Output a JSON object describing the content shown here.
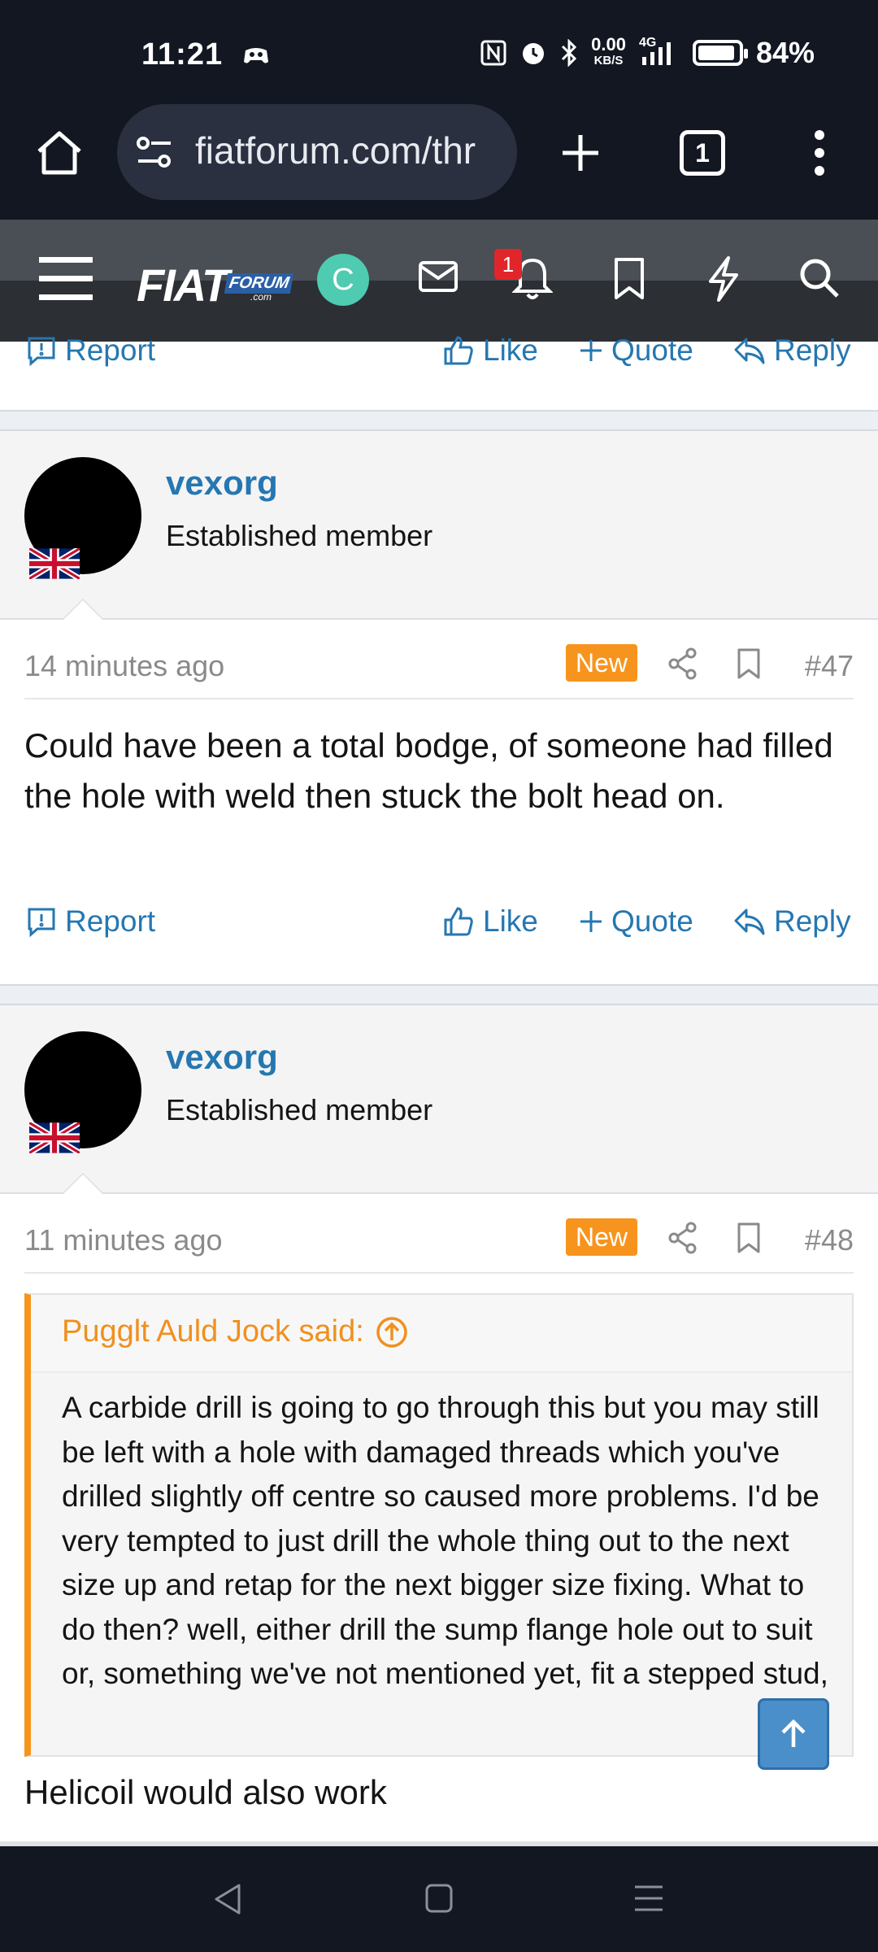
{
  "status_bar": {
    "time": "11:21",
    "net_speed_top": "0.00",
    "net_speed_bottom": "KB/S",
    "network": "4G",
    "battery": "84%"
  },
  "browser": {
    "url": "fiatforum.com/thr",
    "tab_count": "1"
  },
  "forum_nav": {
    "avatar_letter": "C",
    "notification_count": "1"
  },
  "top_actions": {
    "report": "Report",
    "like": "Like",
    "quote": "Quote",
    "reply": "Reply"
  },
  "posts": [
    {
      "username": "vexorg",
      "user_title": "Established member",
      "time": "14 minutes ago",
      "badge": "New",
      "number": "#47",
      "text": "Could have been a total bodge, of someone had filled the hole with weld then stuck the bolt head on.",
      "actions": {
        "report": "Report",
        "like": "Like",
        "quote": "Quote",
        "reply": "Reply"
      }
    },
    {
      "username": "vexorg",
      "user_title": "Established member",
      "time": "11 minutes ago",
      "badge": "New",
      "number": "#48",
      "quote_author": "Pugglt Auld Jock said:",
      "quote_text": "A carbide drill is going to go through this but you may still be left with a hole with damaged threads which you've drilled slightly off centre so caused more problems. I'd be very tempted to just drill the whole thing out to the next size up and retap for the next bigger size fixing. What to do then? well, either drill the sump flange hole out to suit or, something we've not mentioned yet, fit a stepped stud,",
      "text": "Helicoil would also work"
    }
  ],
  "colors": {
    "link_blue": "#2577b1",
    "accent_orange": "#f7941d",
    "dark_bar": "#121722"
  }
}
